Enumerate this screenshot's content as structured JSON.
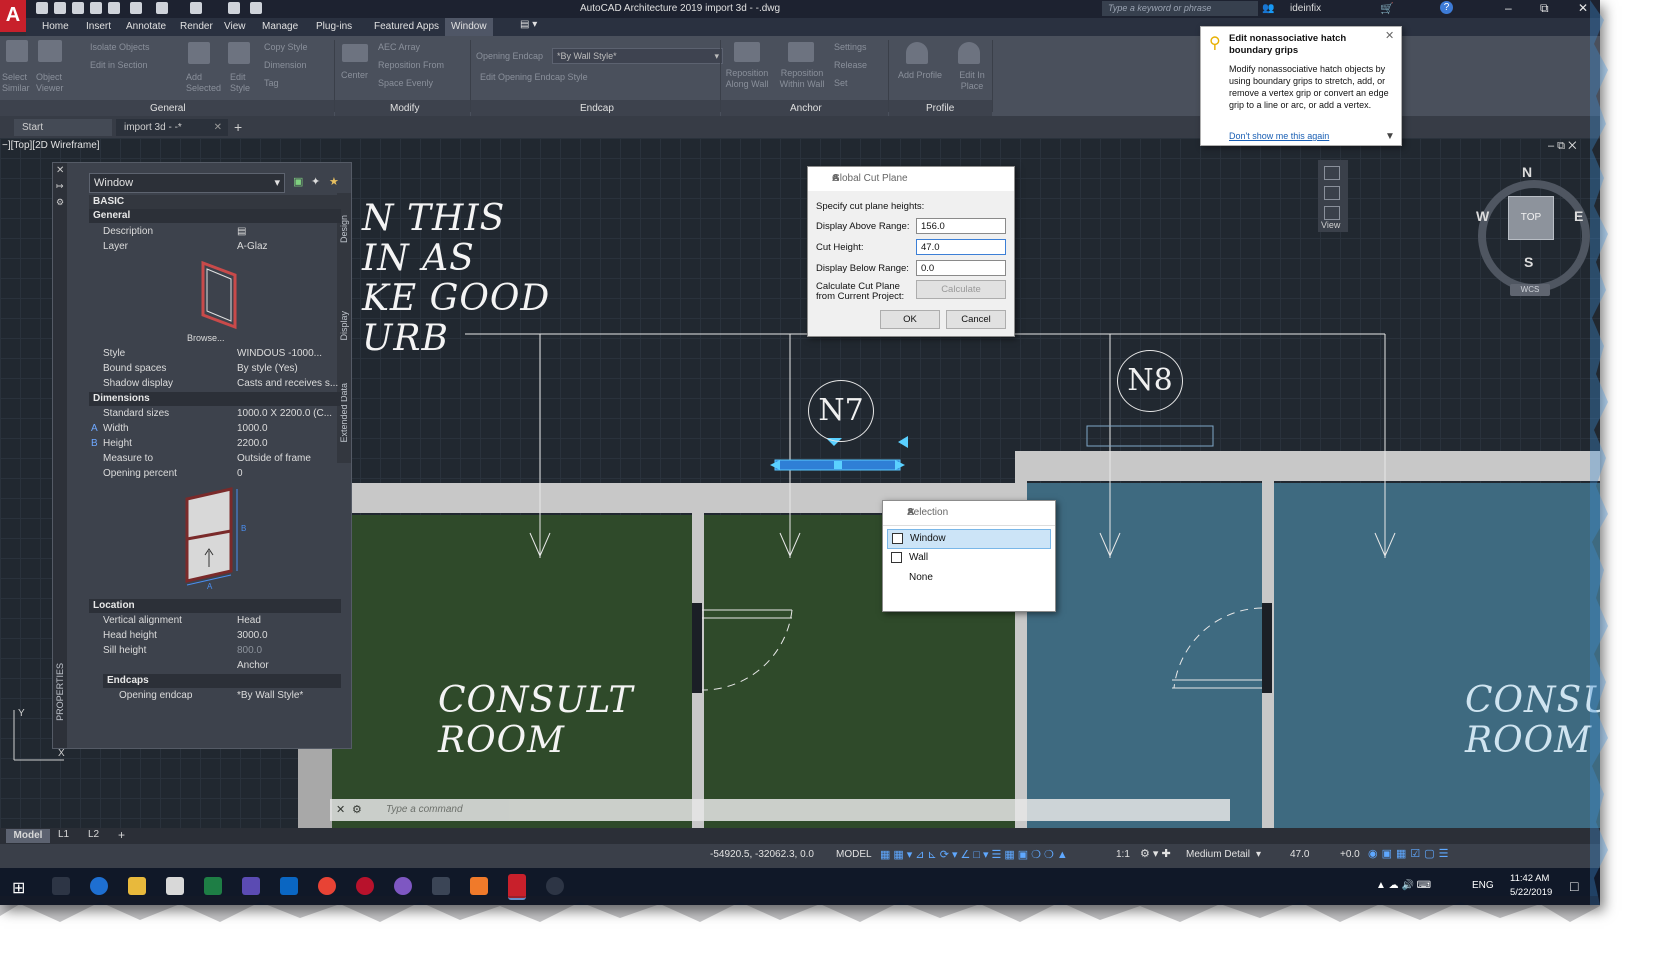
{
  "window": {
    "title": "AutoCAD Architecture 2019   import 3d - -.dwg",
    "search_placeholder": "Type a keyword or phrase",
    "user": "ideinfix"
  },
  "menu": [
    "Home",
    "Insert",
    "Annotate",
    "Render",
    "View",
    "Manage",
    "Plug-ins",
    "Featured Apps",
    "Window"
  ],
  "ribbon": {
    "general": {
      "label": "General",
      "select_similar": "Select Similar",
      "object_viewer": "Object Viewer",
      "isolate_objects": "Isolate Objects",
      "edit_in_section": "Edit in Section",
      "add_selected": "Add Selected",
      "edit_style": "Edit Style",
      "copy_style": "Copy Style",
      "dimension": "Dimension",
      "tag": "Tag"
    },
    "modify": {
      "label": "Modify",
      "center": "Center",
      "aec_array": "AEC Array",
      "reposition_from": "Reposition From",
      "space_evenly": "Space Evenly"
    },
    "endcap": {
      "label": "Endcap",
      "opening_endcap": "Opening Endcap",
      "by_wall_style": "*By Wall Style*",
      "edit_opening_endcap_style": "Edit Opening Endcap Style"
    },
    "anchor": {
      "label": "Anchor",
      "reposition_along_wall": "Reposition Along Wall",
      "reposition_within_wall": "Reposition Within Wall",
      "settings": "Settings",
      "release": "Release",
      "set": "Set"
    },
    "profile": {
      "label": "Profile",
      "add_profile": "Add Profile",
      "edit_in_place": "Edit In Place"
    }
  },
  "doc_tabs": [
    "Start",
    "import 3d - -*"
  ],
  "viewport_label": "−][Top][2D Wireframe]",
  "drawing": {
    "text_lines": [
      "N THIS",
      "IN AS",
      "KE GOOD",
      "URB"
    ],
    "tags": [
      "N7",
      "N8"
    ],
    "room1": [
      "CONSULT",
      "ROOM"
    ],
    "room2": [
      "CONSU",
      "ROOM"
    ]
  },
  "viewcube": {
    "n": "N",
    "s": "S",
    "e": "E",
    "w": "W",
    "top": "TOP",
    "wcs": "WCS",
    "view": "View"
  },
  "properties": {
    "selector": "Window",
    "side_tabs": [
      "Design",
      "Display",
      "Extended Data"
    ],
    "palette_label": "PROPERTIES",
    "sections": {
      "basic": "BASIC",
      "general": "General",
      "dimensions": "Dimensions",
      "location": "Location",
      "endcaps": "Endcaps"
    },
    "general": [
      {
        "k": "Description",
        "v": ""
      },
      {
        "k": "Layer",
        "v": "A-Glaz"
      }
    ],
    "browse": "Browse...",
    "general2": [
      {
        "k": "Style",
        "v": "WINDOUS -1000..."
      },
      {
        "k": "Bound spaces",
        "v": "By style (Yes)"
      },
      {
        "k": "Shadow display",
        "v": "Casts and receives s..."
      }
    ],
    "dimensions": [
      {
        "k": "Standard sizes",
        "v": "1000.0 X 2200.0 (C..."
      },
      {
        "k": "Width",
        "v": "1000.0",
        "mark": "A"
      },
      {
        "k": "Height",
        "v": "2200.0",
        "mark": "B"
      },
      {
        "k": "Measure to",
        "v": "Outside of frame"
      },
      {
        "k": "Opening percent",
        "v": "0"
      }
    ],
    "location": [
      {
        "k": "Vertical alignment",
        "v": "Head"
      },
      {
        "k": "Head height",
        "v": "3000.0"
      },
      {
        "k": "Sill height",
        "v": "800.0"
      },
      {
        "k": "",
        "v": "Anchor"
      }
    ],
    "endcaps": [
      {
        "k": "Opening endcap",
        "v": "*By Wall Style*"
      }
    ]
  },
  "cut_plane_dialog": {
    "title": "Global Cut Plane",
    "heading": "Specify cut plane heights:",
    "above_label": "Display Above Range:",
    "above_value": "156.0",
    "cut_label": "Cut Height:",
    "cut_value": "47.0",
    "below_label": "Display Below Range:",
    "below_value": "0.0",
    "calc_label1": "Calculate Cut Plane",
    "calc_label2": "from Current Project:",
    "calculate": "Calculate",
    "ok": "OK",
    "cancel": "Cancel"
  },
  "selection_dialog": {
    "title": "Selection",
    "items": [
      "Window",
      "Wall",
      "None"
    ]
  },
  "tooltip": {
    "title": "Edit nonassociative hatch boundary grips",
    "body": "Modify nonassociative hatch objects by using boundary grips to stretch, add, or remove a vertex grip or convert an edge grip to a line or arc, or add a vertex.",
    "link": "Don't show me this again"
  },
  "command_placeholder": "Type a command",
  "layout_tabs": [
    "Model",
    "L1",
    "L2"
  ],
  "status": {
    "coords": "-54920.5, -32062.3, 0.0",
    "model": "MODEL",
    "scale": "1:1",
    "detail": "Medium Detail",
    "cut": "47.0",
    "offset": "+0.0"
  },
  "taskbar": {
    "lang": "ENG",
    "time": "11:42 AM",
    "date": "5/22/2019"
  }
}
